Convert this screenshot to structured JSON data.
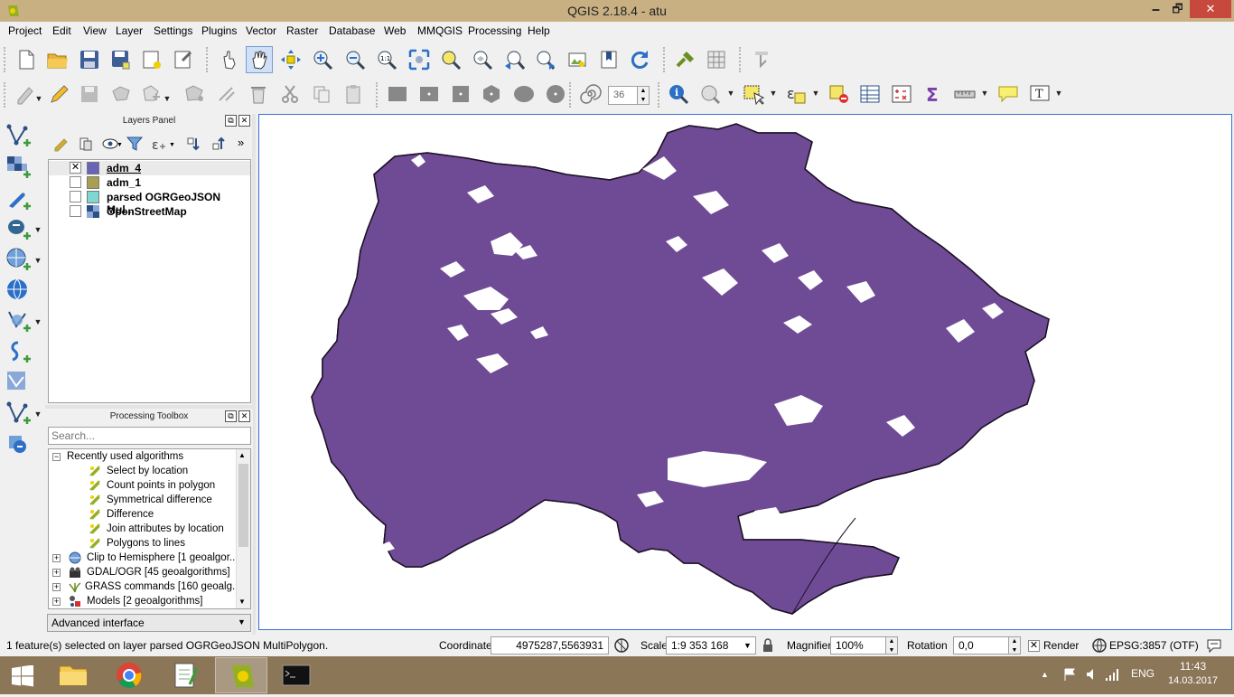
{
  "window": {
    "title": "QGIS 2.18.4 - atu",
    "minimize": "🗕",
    "restore": "🗗",
    "close": "✕"
  },
  "menu": [
    "Project",
    "Edit",
    "View",
    "Layer",
    "Settings",
    "Plugins",
    "Vector",
    "Raster",
    "Database",
    "Web",
    "MMQGIS",
    "Processing",
    "Help"
  ],
  "toolbar2": {
    "font_size_value": "36"
  },
  "layers_panel": {
    "title": "Layers Panel",
    "layers": [
      {
        "name": "adm_4",
        "checked": true,
        "color": "#6a64b8",
        "selected": true
      },
      {
        "name": "adm_1",
        "checked": false,
        "color": "#a8a050"
      },
      {
        "name": "parsed OGRGeoJSON Mul...",
        "checked": false,
        "color": "#7fd8d0"
      },
      {
        "name": "OpenStreetMap",
        "checked": false,
        "color": "raster"
      }
    ],
    "check_mark": "✕"
  },
  "processing_toolbox": {
    "title": "Processing Toolbox",
    "search_placeholder": "Search...",
    "recent_group": "Recently used algorithms",
    "recent": [
      "Select by location",
      "Count points in polygon",
      "Symmetrical difference",
      "Difference",
      "Join attributes by location",
      "Polygons to lines"
    ],
    "providers": [
      "Clip to Hemisphere [1 geoalgor...",
      "GDAL/OGR [45 geoalgorithms]",
      "GRASS commands [160 geoalg...",
      "Models [2 geoalgorithms]"
    ],
    "interface_mode": "Advanced interface"
  },
  "statusbar": {
    "message": "1 feature(s) selected on layer parsed OGRGeoJSON MultiPolygon.",
    "coordinate_label": "Coordinate",
    "coordinate_value": "4975287,5563931",
    "scale_label": "Scale",
    "scale_value": "1:9 353 168",
    "magnifier_label": "Magnifier",
    "magnifier_value": "100%",
    "rotation_label": "Rotation",
    "rotation_value": "0,0",
    "render_label": "Render",
    "render_checked": "✕",
    "crs": "EPSG:3857 (OTF)"
  },
  "taskbar": {
    "language": "ENG",
    "time": "11:43",
    "date": "14.03.2017"
  },
  "colors": {
    "map_fill": "#6e4b94",
    "map_stroke": "#1c1025",
    "titlebar": "#c9b083",
    "taskbar": "#8c7658"
  }
}
